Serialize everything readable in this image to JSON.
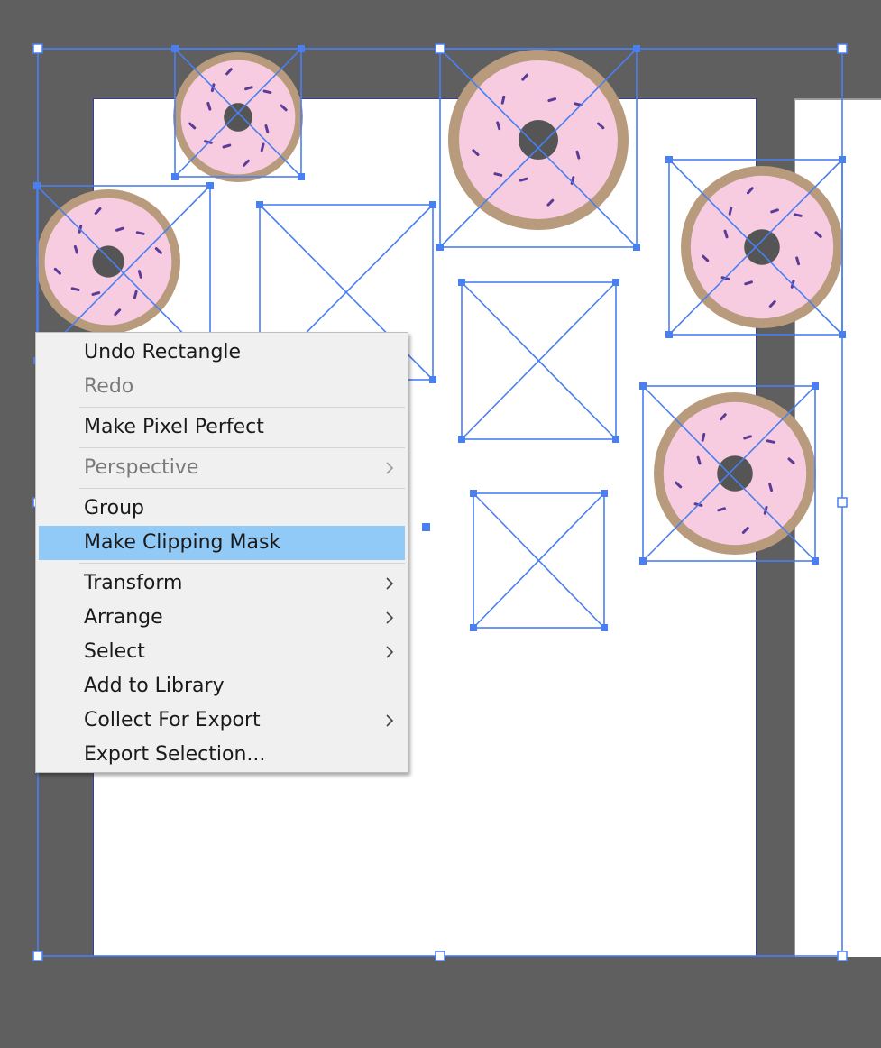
{
  "colors": {
    "workspace": "#5f5f5f",
    "selection": "#4a7ff0",
    "menu_bg": "#f0f0f0",
    "menu_highlight": "#91c9f7",
    "donut_dough": "#b89a7c",
    "donut_icing": "#f7cbe0",
    "donut_sprinkle": "#5b3b96"
  },
  "context_menu": {
    "items": [
      {
        "id": "undo-rectangle",
        "label": "Undo Rectangle",
        "enabled": true,
        "submenu": false
      },
      {
        "id": "redo",
        "label": "Redo",
        "enabled": false,
        "submenu": false
      },
      {
        "separator": true
      },
      {
        "id": "make-pixel-perfect",
        "label": "Make Pixel Perfect",
        "enabled": true,
        "submenu": false
      },
      {
        "separator": true
      },
      {
        "id": "perspective",
        "label": "Perspective",
        "enabled": false,
        "submenu": true
      },
      {
        "separator": true
      },
      {
        "id": "group",
        "label": "Group",
        "enabled": true,
        "submenu": false
      },
      {
        "id": "make-clipping-mask",
        "label": "Make Clipping Mask",
        "enabled": true,
        "submenu": false,
        "highlighted": true
      },
      {
        "separator": true
      },
      {
        "id": "transform",
        "label": "Transform",
        "enabled": true,
        "submenu": true
      },
      {
        "id": "arrange",
        "label": "Arrange",
        "enabled": true,
        "submenu": true
      },
      {
        "id": "select",
        "label": "Select",
        "enabled": true,
        "submenu": true
      },
      {
        "id": "add-to-library",
        "label": "Add to Library",
        "enabled": true,
        "submenu": false
      },
      {
        "id": "collect-for-export",
        "label": "Collect For Export",
        "enabled": true,
        "submenu": true
      },
      {
        "id": "export-selection",
        "label": "Export Selection...",
        "enabled": true,
        "submenu": false
      }
    ]
  }
}
